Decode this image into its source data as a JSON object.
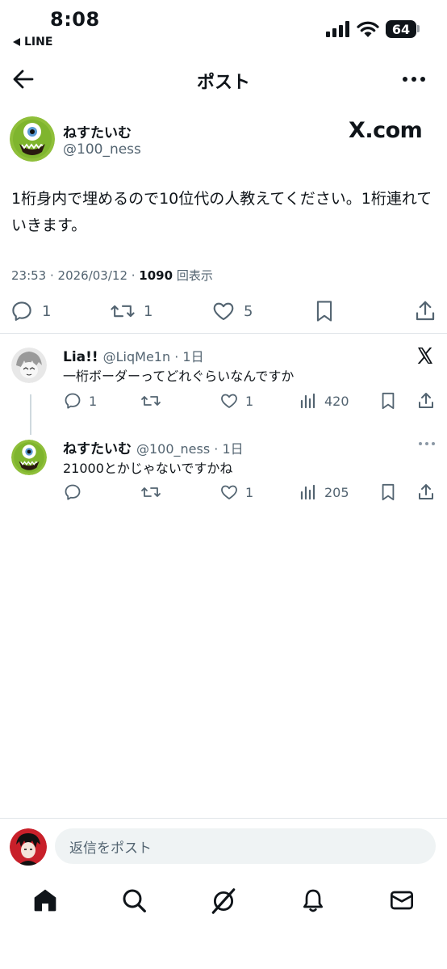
{
  "status_bar": {
    "time": "8:08",
    "back_app": "LINE",
    "battery": "64"
  },
  "header": {
    "title": "ポスト"
  },
  "post": {
    "author_name": "ねすたいむ",
    "author_handle": "@100_ness",
    "source_badge": "X.com",
    "text": "1桁身内で埋めるので10位代の人教えてください。1桁連れていきます。",
    "time": "23:53 · 2026/03/12 · ",
    "views_count": "1090",
    "views_label": " 回表示",
    "replies": "1",
    "reposts": "1",
    "likes": "5"
  },
  "replies": [
    {
      "name": "Lia!!",
      "handle_time": "@LiqMe1n · 1日",
      "text": "一桁ボーダーってどれぐらいなんですか",
      "replies": "1",
      "reposts": "",
      "likes": "1",
      "views": "420"
    },
    {
      "name": "ねすたいむ",
      "handle_time": "@100_ness · 1日",
      "text": "21000とかじゃないですかね",
      "replies": "",
      "reposts": "",
      "likes": "1",
      "views": "205"
    }
  ],
  "compose": {
    "placeholder": "返信をポスト"
  },
  "icons": {
    "back": "back-arrow-icon",
    "more": "more-icon",
    "reply": "reply-icon",
    "repost": "repost-icon",
    "like": "heart-icon",
    "views": "views-icon",
    "bookmark": "bookmark-icon",
    "share": "share-icon",
    "home": "home-icon",
    "search": "search-icon",
    "grok": "grok-icon",
    "notifications": "bell-icon",
    "messages": "mail-icon"
  },
  "colors": {
    "text": "#0f1419",
    "muted": "#536471",
    "divider": "#e1e6ea",
    "input_bg": "#eff3f4"
  }
}
